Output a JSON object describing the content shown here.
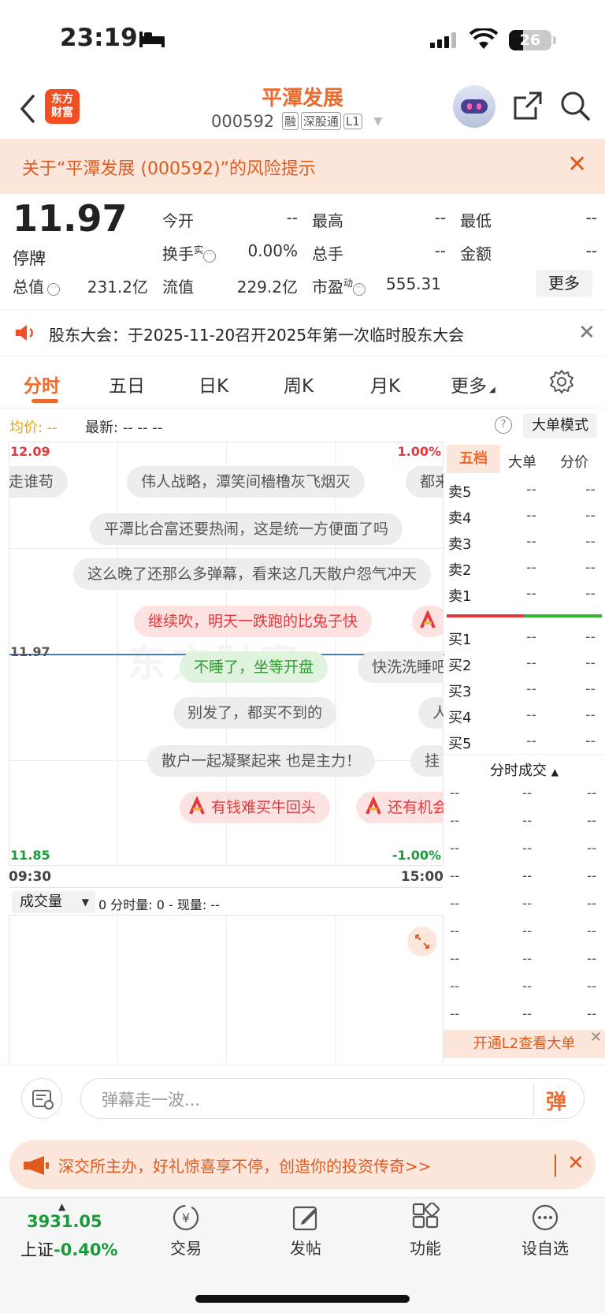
{
  "status_bar": {
    "time": "23:19",
    "battery": "26"
  },
  "header": {
    "logo_line1": "东方",
    "logo_line2": "财富",
    "stock_name": "平潭发展",
    "code": "000592",
    "tags": [
      "融",
      "深股通",
      "L1"
    ]
  },
  "risk_banner": {
    "text": "关于“平潭发展 (000592)”的风险提示"
  },
  "quote": {
    "price": "11.97",
    "status": "停牌",
    "open_label": "今开",
    "open": "--",
    "high_label": "最高",
    "high": "--",
    "low_label": "最低",
    "low": "--",
    "turnover_label": "换手",
    "turnover_sup": "实",
    "turnover": "0.00%",
    "volume_label": "总手",
    "volume": "--",
    "amount_label": "金额",
    "amount": "--",
    "mktcap_label": "总值",
    "mktcap": "231.2亿",
    "float_label": "流值",
    "float": "229.2亿",
    "pe_label": "市盈",
    "pe_sup": "动",
    "pe": "555.31",
    "more": "更多"
  },
  "notice": {
    "text": "股东大会：于2025-11-20召开2025年第一次临时股东大会"
  },
  "tabs": [
    "分时",
    "五日",
    "日K",
    "周K",
    "月K",
    "更多"
  ],
  "info_line": {
    "avg_label": "均价:",
    "avg_value": "--",
    "latest_label": "最新:",
    "latest_values": "--  --  --",
    "big_mode": "大单模式"
  },
  "chart": {
    "y_top": "12.09",
    "y_bottom": "11.85",
    "y_mid": "11.97",
    "pct_top": "1.00%",
    "pct_bottom": "-1.00%",
    "t_start": "09:30",
    "t_end": "15:00",
    "watermark": "东方财富"
  },
  "danmaku": [
    "走谁苟",
    "伟人战略，潭笑间檣橹灰飞烟灭",
    "都来",
    "平潭比合富还要热闹，这是统一方便面了吗",
    "这么晚了还那么多弹幕，看来这几天散户怨气冲天",
    "继续吹，明天一跌跑的比兔子快",
    "不睡了，坐等开盘",
    "快洗洗睡吧",
    "别发了，都买不到的",
    "人",
    "散户一起凝聚起来 也是主力！",
    "挂",
    "有钱难买牛回头",
    "还有机会"
  ],
  "orderbook": {
    "tabs": [
      "五档",
      "大单",
      "分价"
    ],
    "sell": [
      "卖5",
      "卖4",
      "卖3",
      "卖2",
      "卖1"
    ],
    "buy": [
      "买1",
      "买2",
      "买3",
      "买4",
      "买5"
    ],
    "empty": "--",
    "tick_title": "分时成交",
    "l2_promo": "开通L2查看大单"
  },
  "volume": {
    "selector": "成交量",
    "info": "0 分时量: 0 - 现量: --"
  },
  "input": {
    "placeholder": "弹幕走一波...",
    "send": "弹"
  },
  "promo": {
    "text": "深交所主办，好礼惊喜享不停，创造你的投资传奇>>"
  },
  "tabbar": {
    "index_value": "3931.05",
    "index_name": "上证",
    "index_pct": "-0.40%",
    "items": [
      "交易",
      "发帖",
      "功能",
      "设自选"
    ]
  },
  "colors": {
    "accent": "#ec6a2c",
    "up": "#e4393c",
    "down": "#1a9b3a",
    "price_line": "#4a7bd0"
  }
}
